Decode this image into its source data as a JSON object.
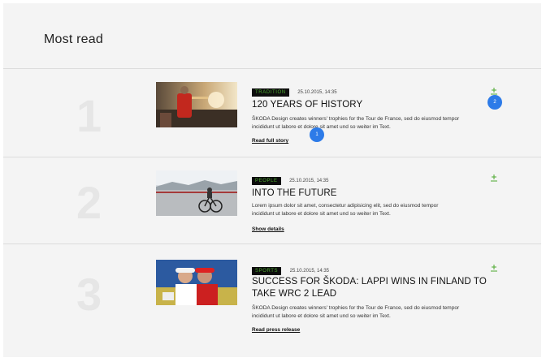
{
  "page": {
    "title": "Most read"
  },
  "articles": [
    {
      "number": "1",
      "tag": "TRADITION",
      "date": "25.10.2015, 14:35",
      "title": "120 YEARS OF HISTORY",
      "description_lines": [
        "ŠKODA Design creates winners' trophies for the Tour de France, sed do eiusmod tempor",
        "incididunt ut labore et dolore sit amet und so weiter im Text."
      ],
      "link": "Read full story",
      "image": "cyclist-podium-photo"
    },
    {
      "number": "2",
      "tag": "PEOPLE",
      "date": "25.10.2015, 14:35",
      "title": "INTO THE FUTURE",
      "description_lines": [
        "Lorem ipsum dolor sit amet, consectetur adipisicing elit, sed do eiusmod tempor",
        "incididunt ut labore et dolore sit amet und so weiter im Text."
      ],
      "link": "Show details",
      "image": "cyclist-road-photo"
    },
    {
      "number": "3",
      "tag": "SPORTS",
      "date": "25.10.2015, 14:35",
      "title_lines": [
        "SUCCESS FOR ŠKODA: LAPPI WINS IN FINLAND TO",
        "TAKE WRC 2 LEAD"
      ],
      "description_lines": [
        "ŠKODA Design creates winners' trophies for the Tour de France, sed do eiusmod tempor",
        "incididunt ut labore et dolore sit amet und so weiter im Text."
      ],
      "link": "Read press release",
      "image": "cyclists-celebrating-photo"
    }
  ],
  "badges": {
    "one": "1",
    "two": "2"
  },
  "colors": {
    "accent": "#4ba82e",
    "tag_bg": "#0d0d0d",
    "badge": "#2d7be8"
  },
  "icons": {
    "add": "plus-download-icon"
  }
}
